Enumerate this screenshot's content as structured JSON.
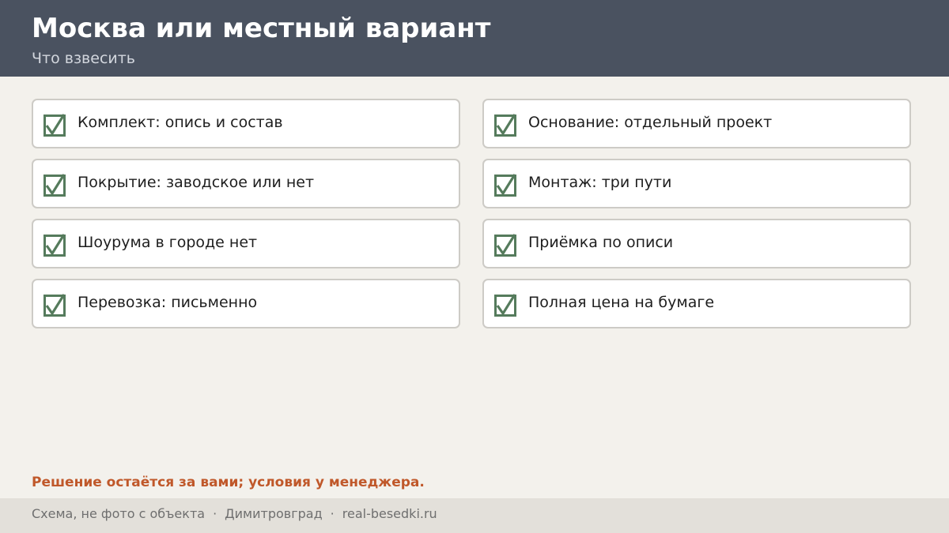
{
  "header": {
    "title": "Москва или местный вариант",
    "subtitle": "Что взвесить"
  },
  "checklist": [
    {
      "label": "Комплект: опись и состав",
      "checked": true
    },
    {
      "label": "Основание: отдельный проект",
      "checked": true
    },
    {
      "label": "Покрытие: заводское или нет",
      "checked": true
    },
    {
      "label": "Монтаж: три пути",
      "checked": true
    },
    {
      "label": "Шоурума в городе нет",
      "checked": true
    },
    {
      "label": "Приёмка по описи",
      "checked": true
    },
    {
      "label": "Перевозка: письменно",
      "checked": true
    },
    {
      "label": "Полная цена на бумаге",
      "checked": true
    }
  ],
  "note": "Решение остаётся за вами; условия у менеджера.",
  "footer": {
    "caption": "Схема, не фото с объекта",
    "separator": "·",
    "city": "Димитровград",
    "site": "real-besedki.ru"
  },
  "colors": {
    "header_bg": "#4a5260",
    "page_bg": "#f3f1ec",
    "check_green": "#557b5c",
    "note_orange": "#c0582a",
    "footer_bg": "#e3e0da"
  },
  "icons": {
    "check": "checkbox-checked-icon"
  }
}
